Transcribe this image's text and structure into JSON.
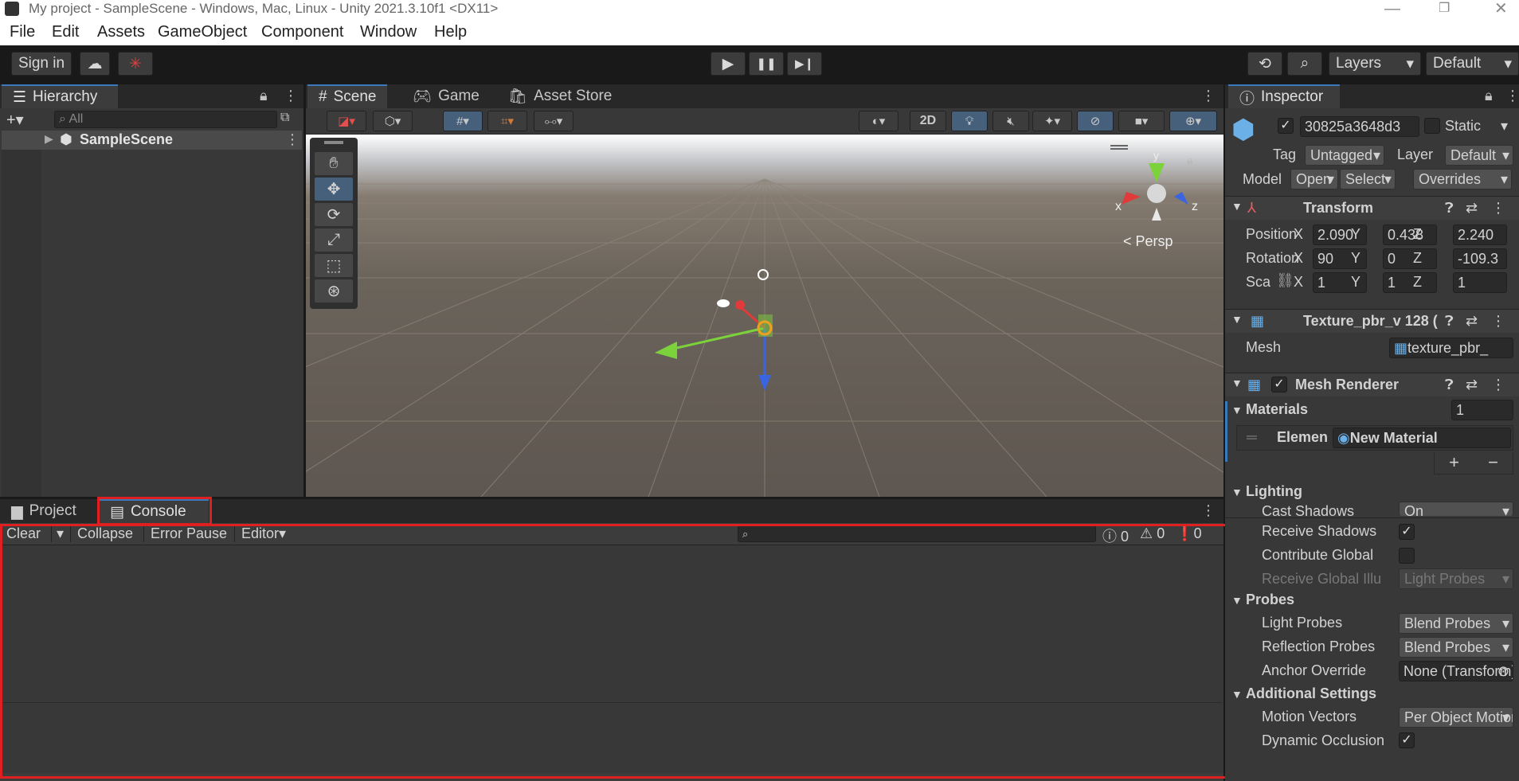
{
  "window": {
    "title": "My project - SampleScene - Windows, Mac, Linux - Unity 2021.3.10f1 <DX11>"
  },
  "menu": [
    "File",
    "Edit",
    "Assets",
    "GameObject",
    "Component",
    "Window",
    "Help"
  ],
  "toolbar": {
    "signin": "Sign in",
    "layers": "Layers",
    "layout": "Default"
  },
  "hierarchy": {
    "tab": "Hierarchy",
    "search_placeholder": "All",
    "scene": "SampleScene"
  },
  "scene_tabs": {
    "scene": "Scene",
    "game": "Game",
    "asset_store": "Asset Store"
  },
  "scene_toolbar": {
    "two_d": "2D"
  },
  "viewport": {
    "persp": "Persp",
    "axis_x": "x",
    "axis_y": "y",
    "axis_z": "z"
  },
  "bottom_tabs": {
    "project": "Project",
    "console": "Console"
  },
  "console": {
    "clear": "Clear",
    "collapse": "Collapse",
    "error_pause": "Error Pause",
    "editor": "Editor",
    "count_errors": "0",
    "count_warnings": "0",
    "count_messages": "0"
  },
  "inspector": {
    "tab": "Inspector",
    "object_name": "30825a3648d3",
    "static": "Static",
    "tag_label": "Tag",
    "tag_value": "Untagged",
    "layer_label": "Layer",
    "layer_value": "Default",
    "model_label": "Model",
    "open": "Open",
    "select": "Select",
    "overrides": "Overrides",
    "transform": {
      "title": "Transform",
      "position": "Position",
      "rotation": "Rotation",
      "scale": "Sca",
      "pos": {
        "x": "2.090",
        "y": "0.438",
        "z": "2.240"
      },
      "rot": {
        "x": "90",
        "y": "0",
        "z": "-109.3"
      },
      "scl": {
        "x": "1",
        "y": "1",
        "z": "1"
      }
    },
    "meshfilter": {
      "title": "Texture_pbr_v 128 (",
      "mesh_label": "Mesh",
      "mesh_value": "texture_pbr_"
    },
    "renderer": {
      "title": "Mesh Renderer",
      "materials": "Materials",
      "materials_count": "1",
      "element": "Elemen",
      "material": "New Material"
    },
    "lighting": {
      "title": "Lighting",
      "cast_shadows": "Cast Shadows",
      "cast_value": "On",
      "receive_shadows": "Receive Shadows",
      "contribute_gi": "Contribute Global",
      "receive_gi": "Receive Global Illu",
      "receive_gi_value": "Light Probes"
    },
    "probes": {
      "title": "Probes",
      "light_probes": "Light Probes",
      "light_value": "Blend Probes",
      "reflection_probes": "Reflection Probes",
      "reflection_value": "Blend Probes",
      "anchor": "Anchor Override",
      "anchor_value": "None (Transform)"
    },
    "additional": {
      "title": "Additional Settings",
      "motion": "Motion Vectors",
      "motion_value": "Per Object Motion",
      "occlusion": "Dynamic Occlusion"
    }
  },
  "colors": {
    "accent": "#3a79bb",
    "highlight": "#e02020",
    "x_axis": "#e03a3a",
    "y_axis": "#7bd23a",
    "z_axis": "#3a64e0"
  }
}
